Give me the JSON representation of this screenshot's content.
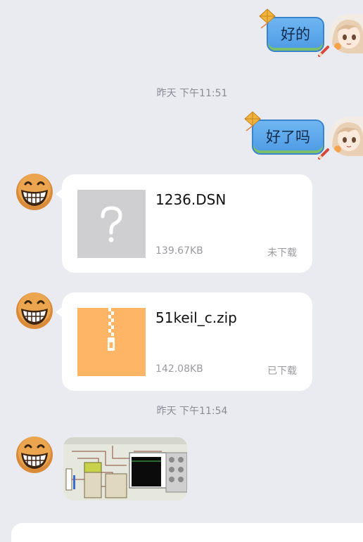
{
  "messages": {
    "out1": {
      "text": "好的"
    },
    "time1": "昨天 下午11:51",
    "out2": {
      "text": "好了吗"
    },
    "file1": {
      "name": "1236.DSN",
      "size": "139.67KB",
      "status": "未下载"
    },
    "file2": {
      "name": "51keil_c.zip",
      "size": "142.08KB",
      "status": "已下载"
    },
    "time2": "昨天 下午11:54"
  },
  "colors": {
    "background": "#eaeaf1",
    "bubble_out": "#5aa6ea",
    "unknown_file_icon": "#cfcfd1",
    "zip_file_icon": "#ffb566"
  },
  "icons": {
    "unknown_file": "question-mark-file-icon",
    "zip_file": "zip-file-icon",
    "contact_avatar": "grinning-emoji-avatar",
    "self_avatar": "anime-girl-avatar"
  }
}
